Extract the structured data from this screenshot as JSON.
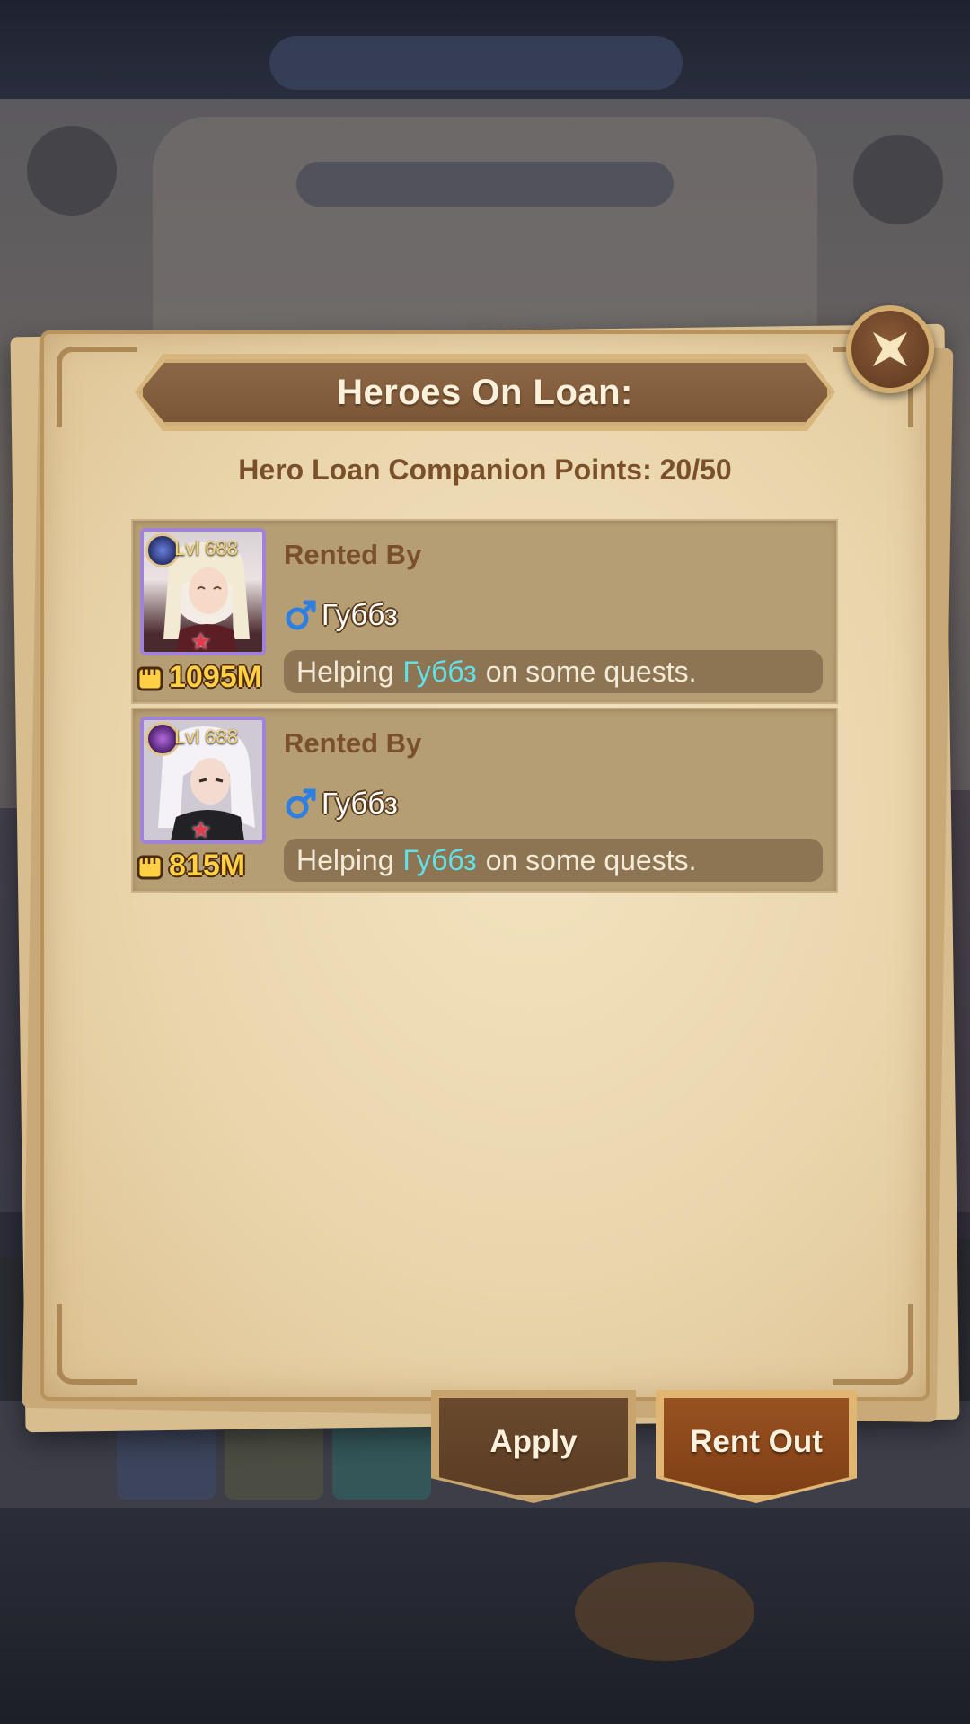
{
  "dialog": {
    "title": "Heroes On Loan:",
    "points_text": "Hero Loan Companion Points: 20/50"
  },
  "loans": [
    {
      "level": "Lvl 688",
      "power": "1095M",
      "rented_by_label": "Rented By",
      "renter": "Губбз",
      "message_pre": "Helping",
      "message_name": "Губбз",
      "message_post": "on some quests."
    },
    {
      "level": "Lvl 688",
      "power": "815M",
      "rented_by_label": "Rented By",
      "renter": "Губбз",
      "message_pre": "Helping",
      "message_name": "Губбз",
      "message_post": "on some quests."
    }
  ],
  "buttons": {
    "apply": "Apply",
    "rent_out": "Rent Out"
  },
  "icons": {
    "close": "close-icon",
    "gender": "male-icon",
    "power": "fist-icon"
  },
  "colors": {
    "panel": "#ead6ad",
    "title_ribbon": "#7a5535",
    "text_brown": "#7a4f2b",
    "highlight_name": "#5fe3e9",
    "power_gold": "#ffd044"
  }
}
